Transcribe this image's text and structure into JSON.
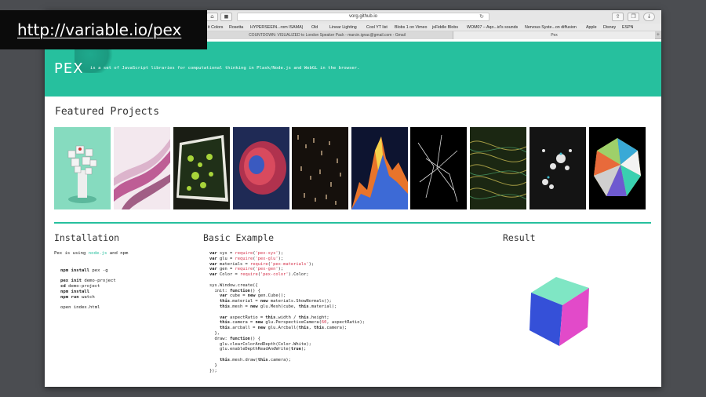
{
  "overlay": {
    "url_text": "http://variable.io/pex"
  },
  "browser": {
    "address": "vorg.github.io",
    "bookmarks": [
      "it Colors",
      "Rosetta",
      "HYPERSEEIN...rom ISAMA)",
      "Old",
      "Linear Lighting",
      "Cool YT list",
      "Blobs 1 on Vimeo",
      "jsFiddle Blobs",
      "WOM07 – Aqo...id's sounds",
      "Nervous Syste...on diffusion",
      "Apple",
      "Disney",
      "ESPN"
    ],
    "tabs": [
      {
        "label": "COUNTDOWN: VISUALIZED to London Speaker Pack - marcin.ignac@gmail.com - Gmail"
      },
      {
        "label": "Pex"
      }
    ]
  },
  "header": {
    "logo": "PEX",
    "tagline": "is a set of JavaScript libraries for computational thinking in Plask/Node.js and WebGL in the browser."
  },
  "featured": {
    "title": "Featured Projects"
  },
  "installation": {
    "title": "Installation",
    "intro_prefix": "Pex is using",
    "intro_link": "node.js",
    "intro_suffix": "and npm"
  },
  "example": {
    "title": "Basic Example"
  },
  "result": {
    "title": "Result"
  },
  "colors": {
    "accent": "#26c09e",
    "string": "#d6324b"
  }
}
